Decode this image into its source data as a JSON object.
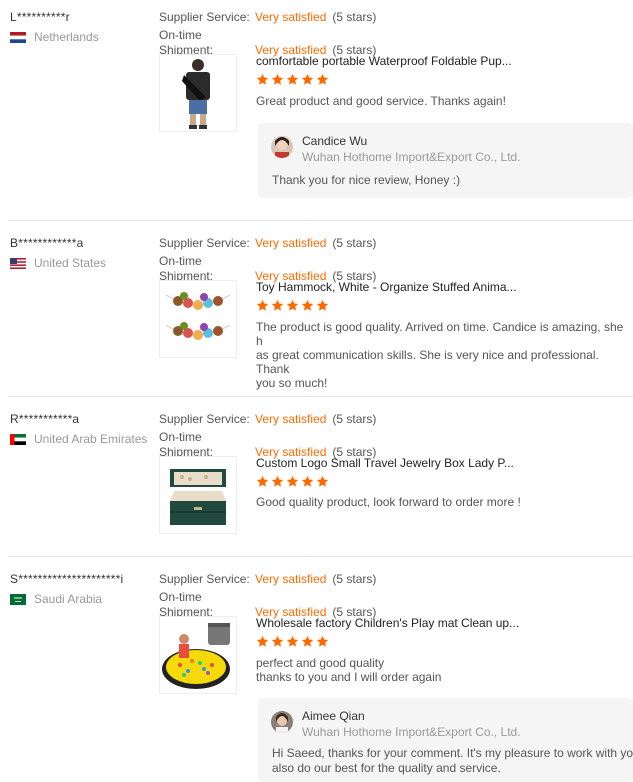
{
  "colors": {
    "accent": "#ff6a00",
    "separator": "#e4e4e4",
    "reply_bg": "#f5f5f5"
  },
  "labels": {
    "supplier_service": "Supplier Service:",
    "on_time": "On-time",
    "shipment": "Shipment:"
  },
  "reviews": [
    {
      "user": "L**********r",
      "country": "Netherlands",
      "flag": "netherlands-flag-icon",
      "supplier_rating": "Very satisfied",
      "supplier_stars": "(5 stars)",
      "shipment_rating": "Very satisfied",
      "shipment_stars": "(5 stars)",
      "product_title": "comfortable portable Waterproof Foldable Pup...",
      "product_image": "pet-carrier-sling-image",
      "stars": 5,
      "text": "Great product and good service. Thanks again!",
      "reply": {
        "name": "Candice Wu",
        "company": "Wuhan Hothome Import&Export Co., Ltd.",
        "text": "Thank you for nice review, Honey :)"
      }
    },
    {
      "user": "B************a",
      "country": "United States",
      "flag": "united-states-flag-icon",
      "supplier_rating": "Very satisfied",
      "supplier_stars": "(5 stars)",
      "shipment_rating": "Very satisfied",
      "shipment_stars": "(5 stars)",
      "product_title": "Toy Hammock, White - Organize Stuffed Anima...",
      "product_image": "toy-hammock-image",
      "stars": 5,
      "text_lines": [
        "The product is good quality. Arrived on time. Candice is amazing, she h",
        "as great communication skills. She is very nice and professional. Thank",
        "you so much!"
      ]
    },
    {
      "user": "R***********a",
      "country": "United Arab Emirates",
      "flag": "uae-flag-icon",
      "supplier_rating": "Very satisfied",
      "supplier_stars": "(5 stars)",
      "shipment_rating": "Very satisfied",
      "shipment_stars": "(5 stars)",
      "product_title": "Custom Logo Small Travel Jewelry Box Lady P...",
      "product_image": "jewelry-box-image",
      "stars": 5,
      "text": "Good quality product, look forward to order more !"
    },
    {
      "user": "S*********************i",
      "country": "Saudi Arabia",
      "flag": "saudi-arabia-flag-icon",
      "supplier_rating": "Very satisfied",
      "supplier_stars": "(5 stars)",
      "shipment_rating": "Very satisfied",
      "shipment_stars": "(5 stars)",
      "product_title": "Wholesale factory Children's Play mat Clean up...",
      "product_image": "play-mat-image",
      "stars": 5,
      "text_lines": [
        "perfect and good quality",
        "thanks to you and I will order again"
      ],
      "reply": {
        "name": "Aimee Qian",
        "company": "Wuhan Hothome Import&Export Co., Ltd.",
        "text_lines": [
          "Hi Saeed, thanks for your comment. It's my pleasure to work with you,",
          "also do our best for the quality and service."
        ]
      }
    }
  ]
}
